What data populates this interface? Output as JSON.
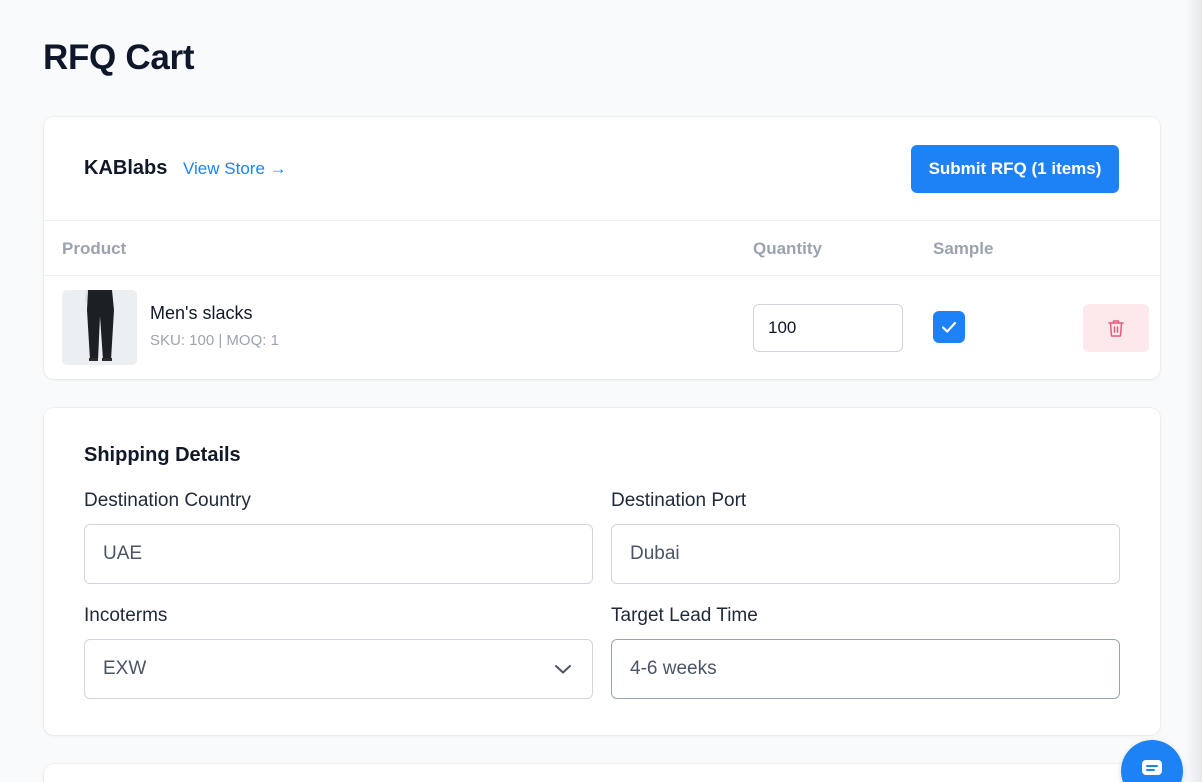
{
  "page": {
    "title": "RFQ Cart"
  },
  "store": {
    "name": "KABlabs",
    "view_store_label": "View Store →",
    "submit_label": "Submit RFQ (1 items)"
  },
  "table": {
    "headers": {
      "product": "Product",
      "quantity": "Quantity",
      "sample": "Sample"
    },
    "rows": [
      {
        "name": "Men's slacks",
        "meta": "SKU: 100 | MOQ: 1",
        "quantity": "100",
        "sample_checked": true,
        "icon_delete": "trash-icon"
      }
    ]
  },
  "shipping": {
    "title": "Shipping Details",
    "destination_country_label": "Destination Country",
    "destination_country_value": "UAE",
    "destination_port_label": "Destination Port",
    "destination_port_value": "Dubai",
    "incoterms_label": "Incoterms",
    "incoterms_value": "EXW",
    "target_lead_time_label": "Target Lead Time",
    "target_lead_time_value": "4-6 weeks"
  },
  "colors": {
    "accent": "#1d82f5",
    "delete_bg": "#fde8ec",
    "delete_icon": "#e85b78"
  },
  "icons": {
    "checkbox": "check-icon",
    "select": "chevron-down-icon",
    "chat": "chat-icon"
  }
}
